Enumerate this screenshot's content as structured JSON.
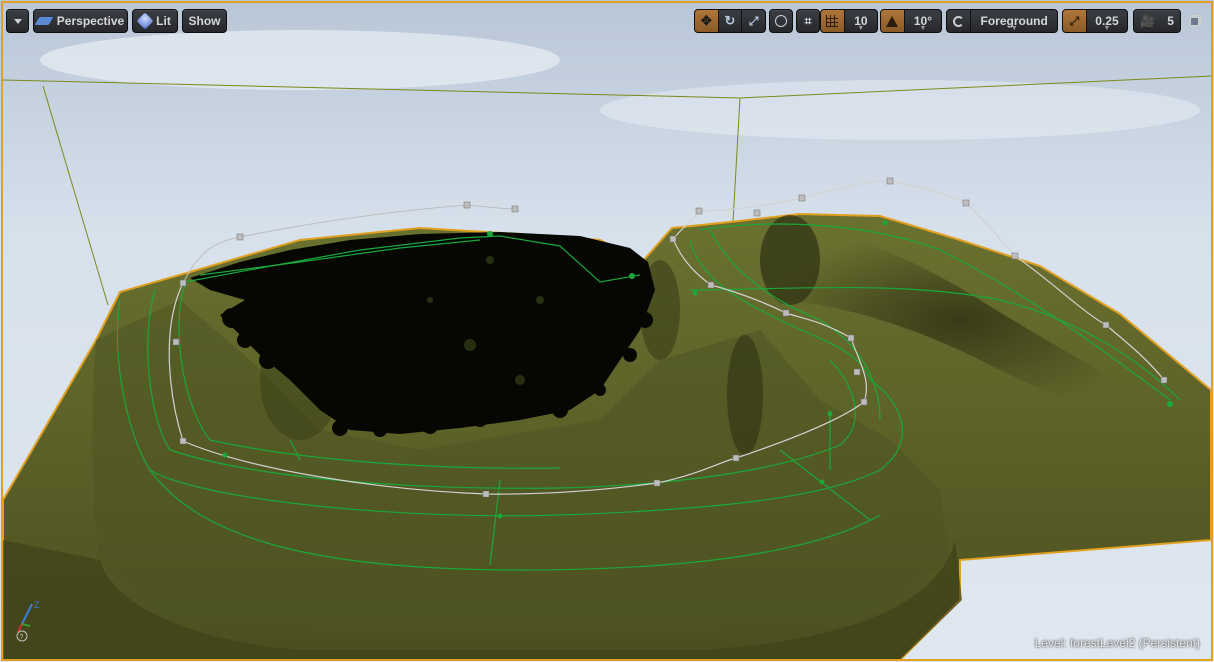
{
  "toolbar": {
    "view_mode": "Perspective",
    "lighting": "Lit",
    "show": "Show",
    "grid_snap_value": "10",
    "rotation_snap_value": "10°",
    "camera_speed_value": "5",
    "scale_snap_value": "0.25",
    "layer": "Foreground"
  },
  "status": {
    "level_prefix": "Level:",
    "level_name": "forestLevel2 (Persistent)"
  },
  "colors": {
    "selection_border": "#e0a020",
    "spline_green": "#1aa83a",
    "terrain": "#5a6128",
    "sky_top": "#c9d4e2"
  },
  "icons": [
    "dropdown-icon",
    "perspective-icon",
    "lit-sphere-icon",
    "translate-icon",
    "rotate-icon",
    "scale-icon",
    "world-local-icon",
    "surface-snap-icon",
    "grid-snap-icon",
    "rotation-snap-icon",
    "scale-snap-icon",
    "camera-speed-icon",
    "maximize-icon",
    "axis-indicator-icon"
  ]
}
